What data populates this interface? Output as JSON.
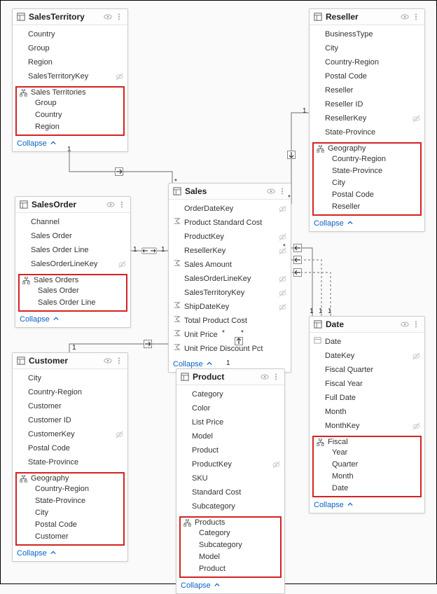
{
  "collapse_label": "Collapse",
  "tables": {
    "salesTerritory": {
      "title": "SalesTerritory",
      "fields": [
        {
          "label": "Country",
          "hidden": false,
          "icon": null
        },
        {
          "label": "Group",
          "hidden": false,
          "icon": null
        },
        {
          "label": "Region",
          "hidden": false,
          "icon": null
        },
        {
          "label": "SalesTerritoryKey",
          "hidden": true,
          "icon": null
        }
      ],
      "hierarchy": {
        "name": "Sales Territories",
        "highlighted": true,
        "levels": [
          "Group",
          "Country",
          "Region"
        ]
      }
    },
    "reseller": {
      "title": "Reseller",
      "fields": [
        {
          "label": "BusinessType",
          "hidden": false,
          "icon": null
        },
        {
          "label": "City",
          "hidden": false,
          "icon": null
        },
        {
          "label": "Country-Region",
          "hidden": false,
          "icon": null
        },
        {
          "label": "Postal Code",
          "hidden": false,
          "icon": null
        },
        {
          "label": "Reseller",
          "hidden": false,
          "icon": null
        },
        {
          "label": "Reseller ID",
          "hidden": false,
          "icon": null
        },
        {
          "label": "ResellerKey",
          "hidden": true,
          "icon": null
        },
        {
          "label": "State-Province",
          "hidden": false,
          "icon": null
        }
      ],
      "hierarchy": {
        "name": "Geography",
        "highlighted": true,
        "levels": [
          "Country-Region",
          "State-Province",
          "City",
          "Postal Code",
          "Reseller"
        ]
      }
    },
    "salesOrder": {
      "title": "SalesOrder",
      "fields": [
        {
          "label": "Channel",
          "hidden": false,
          "icon": null
        },
        {
          "label": "Sales Order",
          "hidden": false,
          "icon": null
        },
        {
          "label": "Sales Order Line",
          "hidden": false,
          "icon": null
        },
        {
          "label": "SalesOrderLineKey",
          "hidden": true,
          "icon": null
        }
      ],
      "hierarchy": {
        "name": "Sales Orders",
        "highlighted": true,
        "levels": [
          "Sales Order",
          "Sales Order Line"
        ]
      }
    },
    "sales": {
      "title": "Sales",
      "fields": [
        {
          "label": "OrderDateKey",
          "hidden": true,
          "icon": null
        },
        {
          "label": "Product Standard Cost",
          "hidden": false,
          "icon": "sigma"
        },
        {
          "label": "ProductKey",
          "hidden": true,
          "icon": null
        },
        {
          "label": "ResellerKey",
          "hidden": true,
          "icon": null
        },
        {
          "label": "Sales Amount",
          "hidden": false,
          "icon": "sigma"
        },
        {
          "label": "SalesOrderLineKey",
          "hidden": true,
          "icon": null
        },
        {
          "label": "SalesTerritoryKey",
          "hidden": true,
          "icon": null
        },
        {
          "label": "ShipDateKey",
          "hidden": true,
          "icon": "sigma"
        },
        {
          "label": "Total Product Cost",
          "hidden": false,
          "icon": "sigma"
        },
        {
          "label": "Unit Price",
          "hidden": false,
          "icon": "sigma"
        },
        {
          "label": "Unit Price Discount Pct",
          "hidden": false,
          "icon": "sigma"
        }
      ]
    },
    "customer": {
      "title": "Customer",
      "fields": [
        {
          "label": "City",
          "hidden": false,
          "icon": null
        },
        {
          "label": "Country-Region",
          "hidden": false,
          "icon": null
        },
        {
          "label": "Customer",
          "hidden": false,
          "icon": null
        },
        {
          "label": "Customer ID",
          "hidden": false,
          "icon": null
        },
        {
          "label": "CustomerKey",
          "hidden": true,
          "icon": null
        },
        {
          "label": "Postal Code",
          "hidden": false,
          "icon": null
        },
        {
          "label": "State-Province",
          "hidden": false,
          "icon": null
        }
      ],
      "hierarchy": {
        "name": "Geography",
        "highlighted": true,
        "levels": [
          "Country-Region",
          "State-Province",
          "City",
          "Postal Code",
          "Customer"
        ]
      }
    },
    "product": {
      "title": "Product",
      "fields": [
        {
          "label": "Category",
          "hidden": false,
          "icon": null
        },
        {
          "label": "Color",
          "hidden": false,
          "icon": null
        },
        {
          "label": "List Price",
          "hidden": false,
          "icon": null
        },
        {
          "label": "Model",
          "hidden": false,
          "icon": null
        },
        {
          "label": "Product",
          "hidden": false,
          "icon": null
        },
        {
          "label": "ProductKey",
          "hidden": true,
          "icon": null
        },
        {
          "label": "SKU",
          "hidden": false,
          "icon": null
        },
        {
          "label": "Standard Cost",
          "hidden": false,
          "icon": null
        },
        {
          "label": "Subcategory",
          "hidden": false,
          "icon": null
        }
      ],
      "hierarchy": {
        "name": "Products",
        "highlighted": true,
        "levels": [
          "Category",
          "Subcategory",
          "Model",
          "Product"
        ]
      }
    },
    "date": {
      "title": "Date",
      "fields": [
        {
          "label": "Date",
          "hidden": false,
          "icon": "calendar"
        },
        {
          "label": "DateKey",
          "hidden": true,
          "icon": null
        },
        {
          "label": "Fiscal Quarter",
          "hidden": false,
          "icon": null
        },
        {
          "label": "Fiscal Year",
          "hidden": false,
          "icon": null
        },
        {
          "label": "Full Date",
          "hidden": false,
          "icon": null
        },
        {
          "label": "Month",
          "hidden": false,
          "icon": null
        },
        {
          "label": "MonthKey",
          "hidden": true,
          "icon": null
        }
      ],
      "hierarchy": {
        "name": "Fiscal",
        "highlighted": true,
        "levels": [
          "Year",
          "Quarter",
          "Month",
          "Date"
        ]
      }
    }
  },
  "cardinalities": {
    "salesTerritory_sales_left": "1",
    "salesTerritory_sales_right": "*",
    "salesOrder_sales_left": "1",
    "salesOrder_sales_right": "1",
    "reseller_sales_top": "1",
    "reseller_sales_bottom": "*",
    "customer_sales_left": "1",
    "customer_sales_right": "*",
    "product_sales_bottom": "1",
    "product_sales_top": "*",
    "date_sales_a_left": "*",
    "date_sales_a_right": "1",
    "date_sales_b_right": "1",
    "date_sales_c_right": "1"
  }
}
